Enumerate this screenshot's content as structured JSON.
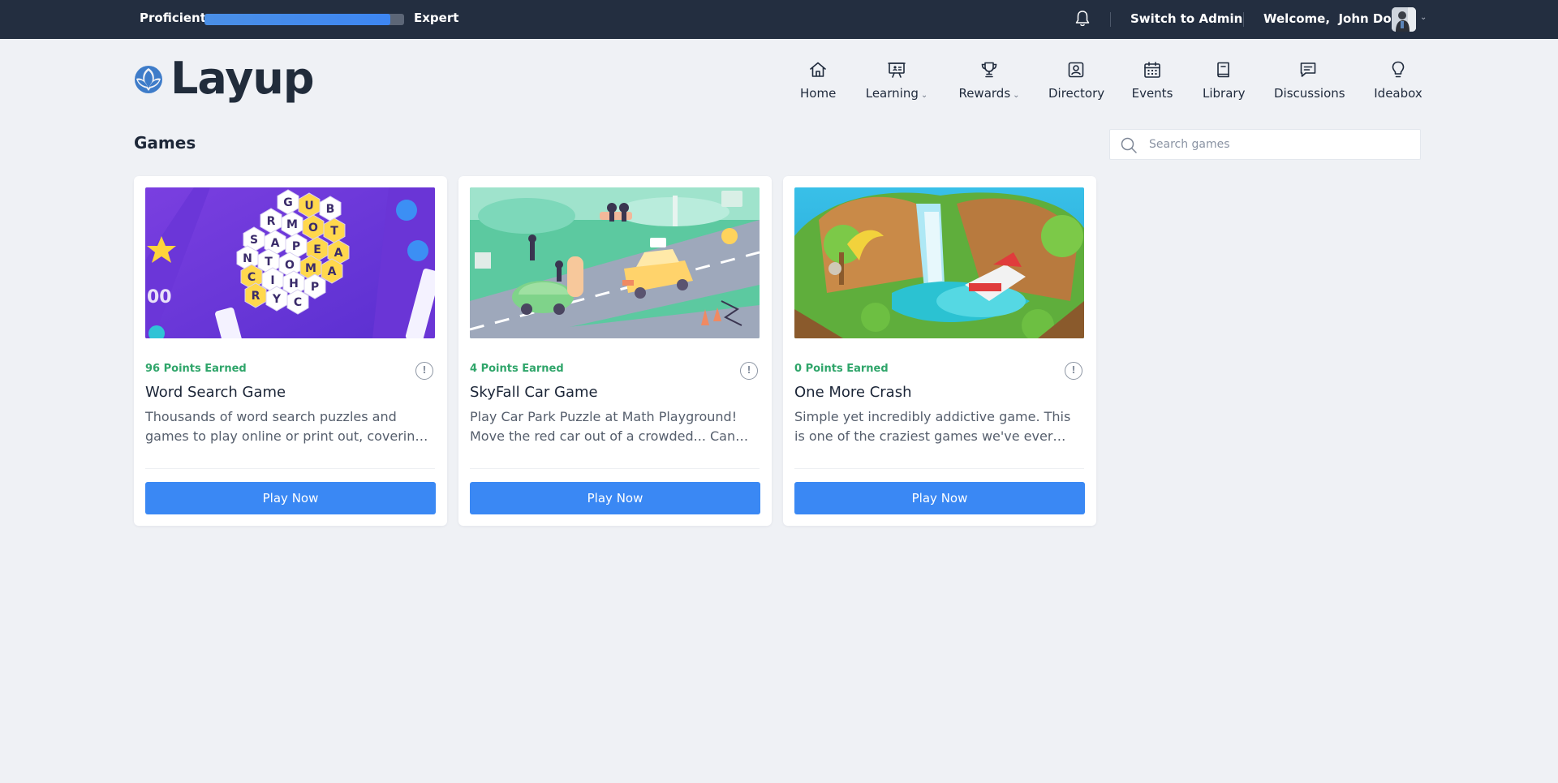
{
  "colors": {
    "topbar_bg": "#232e40",
    "page_bg": "#eff1f5",
    "accent": "#3a88f4",
    "points_green": "#2fa56a"
  },
  "topbar": {
    "level_current": "Proficient",
    "level_next": "Expert",
    "progress_fraction": 0.93,
    "notifications_icon": "bell-icon",
    "switch_admin": "Switch to Admin",
    "welcome": "Welcome,  John Doe",
    "user_menu_icon": "chevron-down-icon"
  },
  "brand": {
    "name": "Layup",
    "logo_icon": "leaf-logo"
  },
  "nav": {
    "items": [
      {
        "label": "Home",
        "icon": "home-icon",
        "dropdown": false
      },
      {
        "label": "Learning",
        "icon": "presentation-icon",
        "dropdown": true
      },
      {
        "label": "Rewards",
        "icon": "trophy-icon",
        "dropdown": true
      },
      {
        "label": "Directory",
        "icon": "contact-card-icon",
        "dropdown": false
      },
      {
        "label": "Events",
        "icon": "calendar-icon",
        "dropdown": false
      },
      {
        "label": "Library",
        "icon": "book-icon",
        "dropdown": false
      },
      {
        "label": "Discussions",
        "icon": "chat-icon",
        "dropdown": false
      },
      {
        "label": "Ideabox",
        "icon": "lightbulb-icon",
        "dropdown": false
      }
    ]
  },
  "main": {
    "title": "Games",
    "search": {
      "placeholder": "Search games",
      "value": ""
    },
    "games": [
      {
        "points": "96 Points Earned",
        "title": "Word Search Game",
        "description": "Thousands of word search puzzles and games to play online or print out, covering ...",
        "button": "Play Now",
        "thumbnail": "word-search-thumbnail",
        "letters": [
          "G",
          "U",
          "B",
          "R",
          "M",
          "O",
          "T",
          "S",
          "A",
          "P",
          "E",
          "A",
          "N",
          "T",
          "O",
          "M",
          "A",
          "C",
          "I",
          "H",
          "P",
          "R",
          "Y",
          "C"
        ]
      },
      {
        "points": "4 Points Earned",
        "title": "SkyFall Car Game",
        "description": "Play Car Park Puzzle at Math Playground! Move the red car out of a crowded... Can yo...",
        "button": "Play Now",
        "thumbnail": "car-game-thumbnail"
      },
      {
        "points": "0 Points Earned",
        "title": "One More Crash",
        "description": "Simple yet incredibly addictive game. This is one of the craziest games we've ever playe...",
        "button": "Play Now",
        "thumbnail": "island-game-thumbnail"
      }
    ]
  }
}
